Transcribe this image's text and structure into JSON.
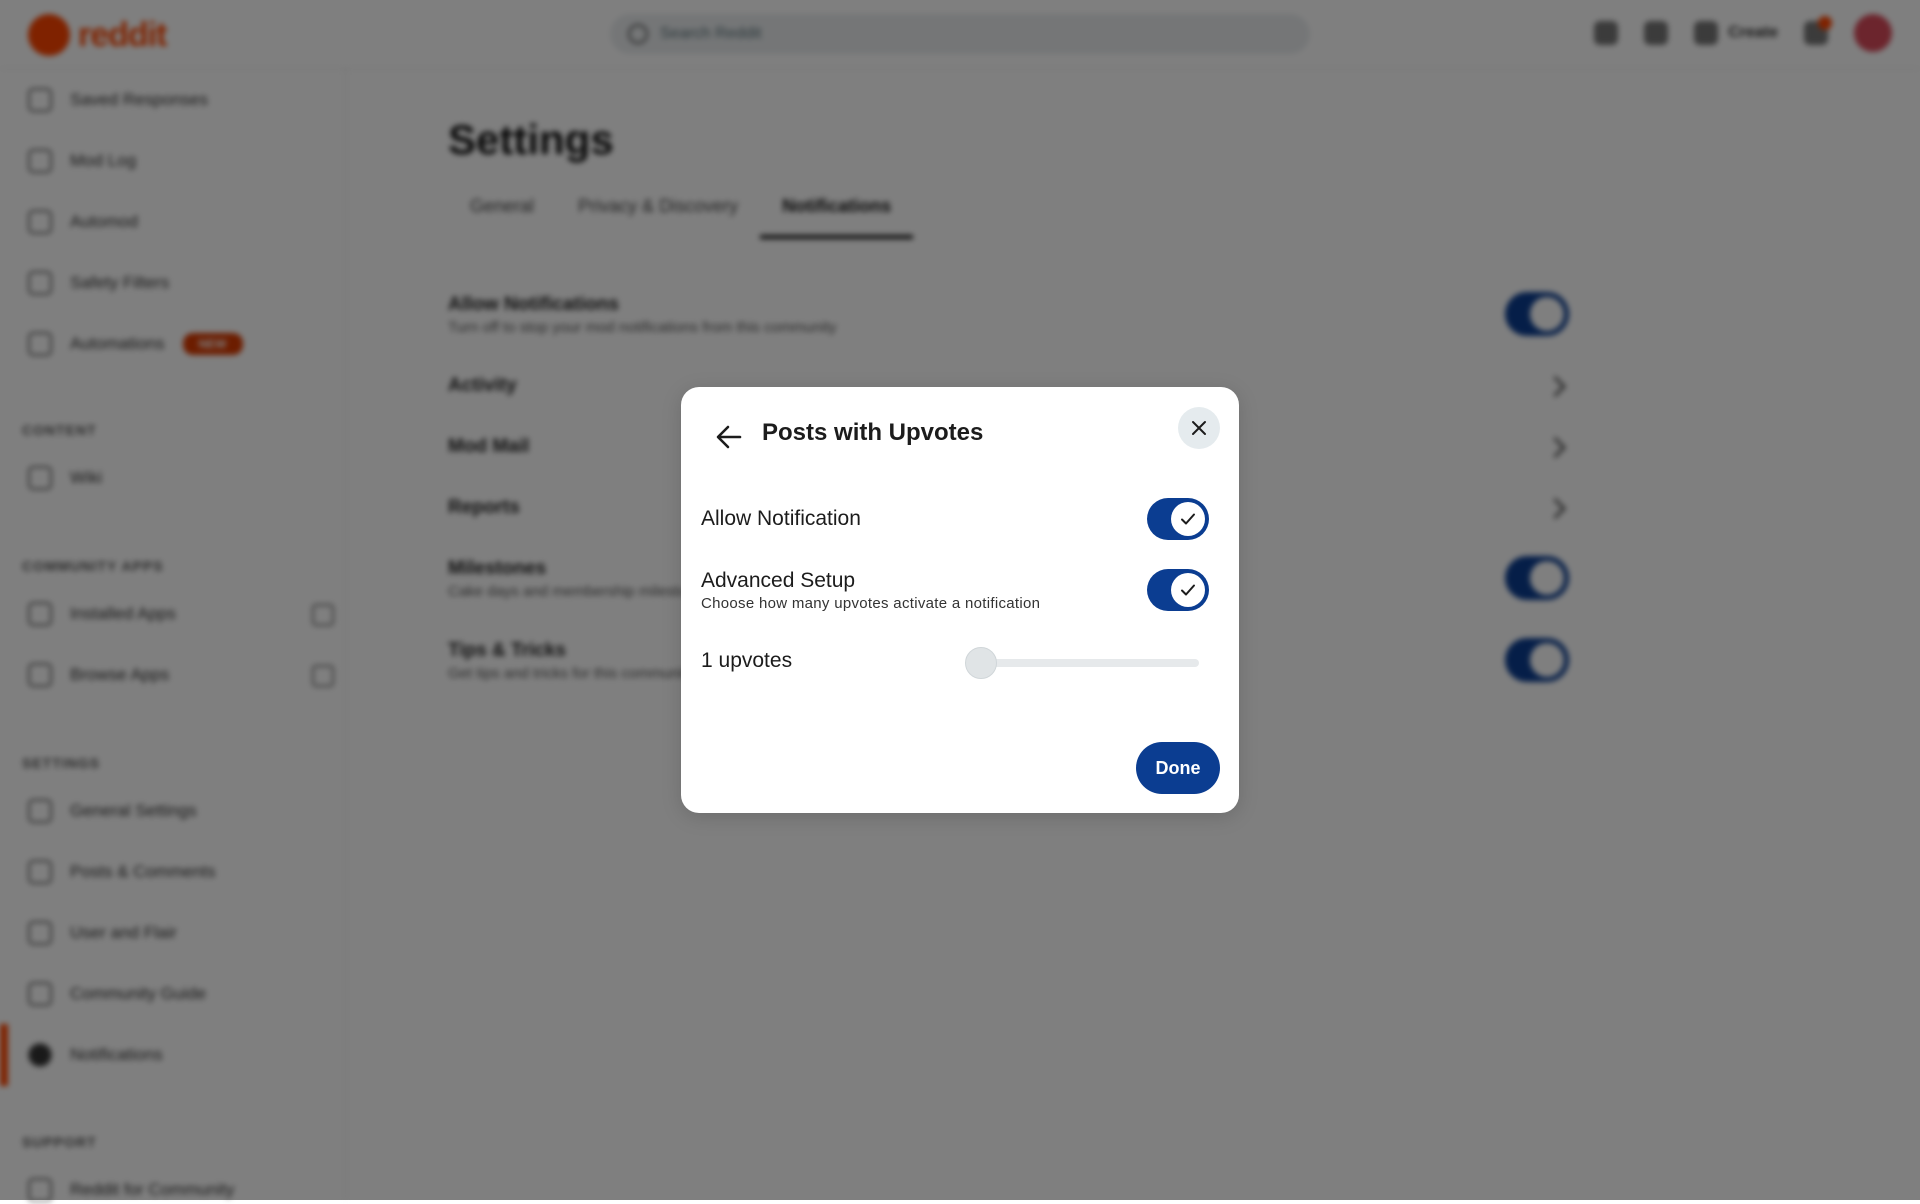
{
  "header": {
    "logo_text": "reddit",
    "search_placeholder": "Search Reddit",
    "create_label": "Create"
  },
  "sidebar": {
    "items_top": [
      {
        "label": "Saved Responses"
      },
      {
        "label": "Mod Log"
      },
      {
        "label": "Automod"
      },
      {
        "label": "Safety Filters"
      },
      {
        "label": "Automations",
        "badge": "NEW"
      }
    ],
    "sections": [
      {
        "heading": "CONTENT",
        "items": [
          {
            "label": "Wiki"
          }
        ]
      },
      {
        "heading": "COMMUNITY APPS",
        "items": [
          {
            "label": "Installed Apps"
          },
          {
            "label": "Browse Apps"
          }
        ]
      },
      {
        "heading": "SETTINGS",
        "items": [
          {
            "label": "General Settings"
          },
          {
            "label": "Posts & Comments"
          },
          {
            "label": "User and Flair"
          },
          {
            "label": "Community Guide"
          },
          {
            "label": "Notifications"
          }
        ]
      },
      {
        "heading": "SUPPORT",
        "items": [
          {
            "label": "Reddit for Community"
          }
        ]
      }
    ]
  },
  "main": {
    "title": "Settings",
    "tabs": [
      {
        "label": "General"
      },
      {
        "label": "Privacy & Discovery"
      },
      {
        "label": "Notifications",
        "active": true
      }
    ],
    "rows": [
      {
        "title": "Allow Notifications",
        "subtitle": "Turn off to stop your mod notifications from this community"
      },
      {
        "title": "Activity"
      },
      {
        "title": "Mod Mail"
      },
      {
        "title": "Reports"
      },
      {
        "title": "Milestones",
        "subtitle": "Cake days and membership milestones"
      },
      {
        "title": "Tips & Tricks",
        "subtitle": "Get tips and tricks for this community"
      }
    ]
  },
  "modal": {
    "title": "Posts with Upvotes",
    "options": [
      {
        "label": "Allow Notification",
        "enabled": true
      },
      {
        "label": "Advanced Setup",
        "description": "Choose how many upvotes activate a notification",
        "enabled": true
      }
    ],
    "slider": {
      "label": "1 upvotes",
      "value": 1,
      "min": 1,
      "max": 100
    },
    "done_label": "Done"
  },
  "colors": {
    "accent": "#0b3d91",
    "brand": "#ff4500",
    "overlay": "rgba(0,0,0,0.5)"
  }
}
